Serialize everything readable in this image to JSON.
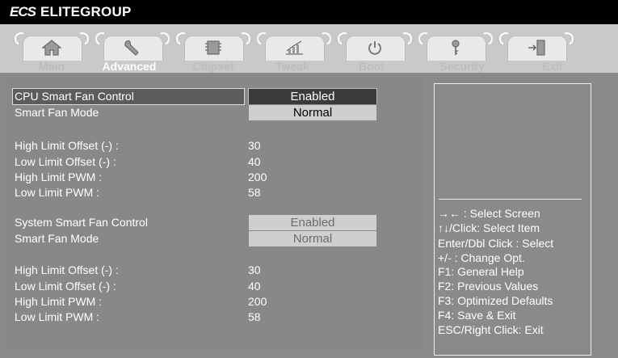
{
  "brand": {
    "logo": "ECS",
    "name": "ELITEGROUP"
  },
  "tabs": [
    {
      "label": "Main",
      "icon": "home-icon",
      "active": false
    },
    {
      "label": "Advanced",
      "icon": "wrench-icon",
      "active": true
    },
    {
      "label": "Chipset",
      "icon": "chip-icon",
      "active": false
    },
    {
      "label": "Tweak",
      "icon": "bar-graph-icon",
      "active": false
    },
    {
      "label": "Boot",
      "icon": "power-icon",
      "active": false
    },
    {
      "label": "Security",
      "icon": "key-icon",
      "active": false
    },
    {
      "label": "Exit",
      "icon": "exit-door-icon",
      "active": false
    }
  ],
  "settings": {
    "cpu_fan_control": {
      "label": "CPU Smart Fan Control",
      "value": "Enabled"
    },
    "cpu_fan_mode": {
      "label": "Smart Fan Mode",
      "value": "Normal"
    },
    "cpu_high_offset": {
      "label": "High Limit Offset (-) :",
      "value": "30"
    },
    "cpu_low_offset": {
      "label": "Low Limit Offset (-) :",
      "value": "40"
    },
    "cpu_high_pwm": {
      "label": "High Limit PWM :",
      "value": "200"
    },
    "cpu_low_pwm": {
      "label": "Low Limit PWM :",
      "value": "58"
    },
    "sys_fan_control": {
      "label": "System Smart Fan Control",
      "value": "Enabled"
    },
    "sys_fan_mode": {
      "label": "Smart Fan Mode",
      "value": "Normal"
    },
    "sys_high_offset": {
      "label": "High Limit Offset (-) :",
      "value": "30"
    },
    "sys_low_offset": {
      "label": "Low Limit Offset (-) :",
      "value": "40"
    },
    "sys_high_pwm": {
      "label": "High Limit PWM :",
      "value": "200"
    },
    "sys_low_pwm": {
      "label": "Low Limit PWM :",
      "value": "58"
    }
  },
  "help": [
    "→← : Select Screen",
    "↑↓/Click: Select Item",
    "Enter/Dbl Click : Select",
    "+/- : Change Opt.",
    "F1: General Help",
    "F2: Previous Values",
    "F3: Optimized Defaults",
    "F4: Save & Exit",
    "ESC/Right Click: Exit"
  ]
}
